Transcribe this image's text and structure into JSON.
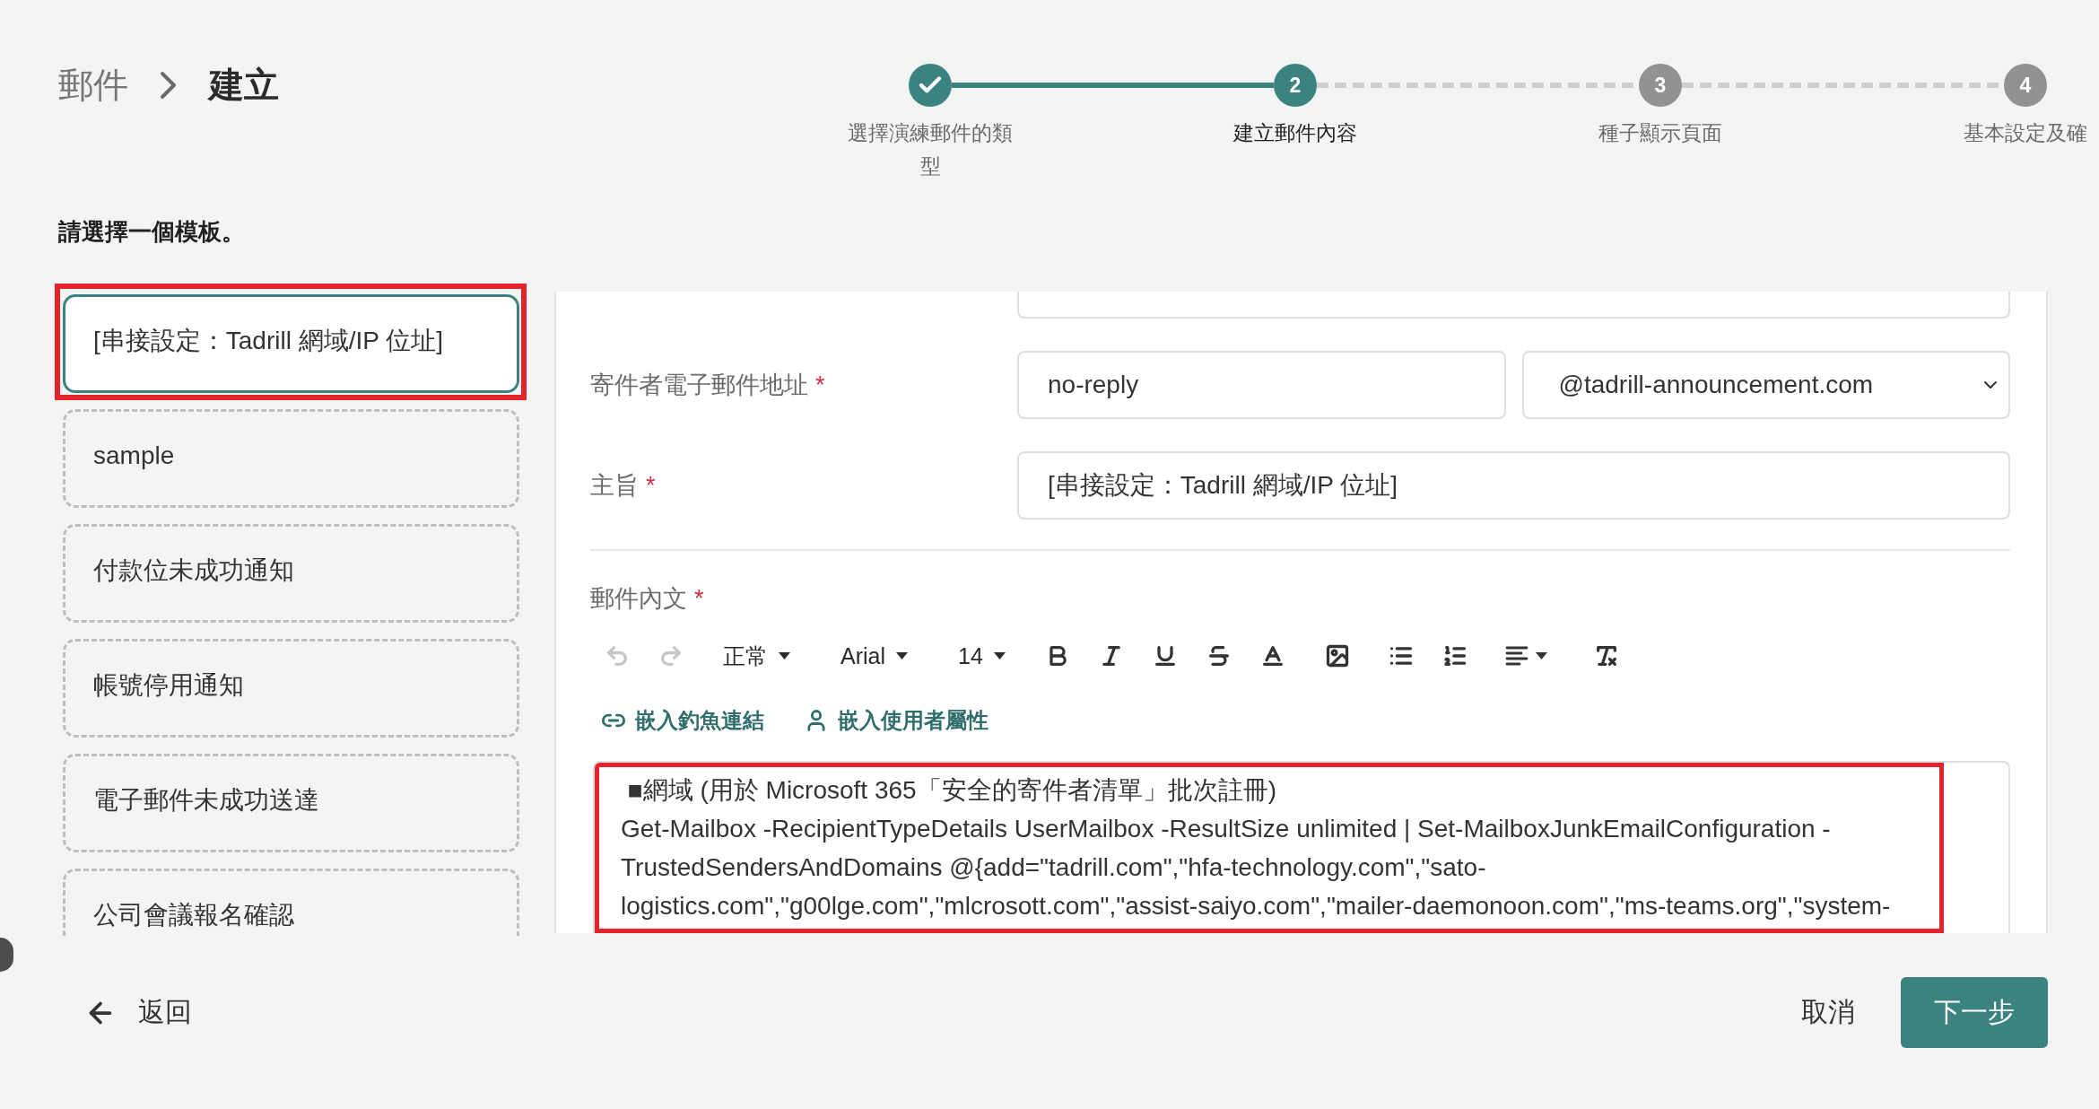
{
  "breadcrumb": [
    {
      "label": "郵件",
      "current": false
    },
    {
      "label": "建立",
      "current": true
    }
  ],
  "steps": [
    {
      "label": "選擇演練郵件的類型",
      "completed": true,
      "selected": false
    },
    {
      "number": "2",
      "label": "建立郵件內容",
      "completed": false,
      "selected": true
    },
    {
      "number": "3",
      "label": "種子顯示頁面",
      "completed": false,
      "selected": false
    },
    {
      "number": "4",
      "label": "基本設定及確",
      "completed": false,
      "selected": false
    }
  ],
  "instruction": "請選擇一個模板。",
  "templates": [
    {
      "label": "[串接設定：Tadrill 網域/IP 位址]",
      "selected": true
    },
    {
      "label": "sample",
      "selected": false
    },
    {
      "label": "付款位未成功通知",
      "selected": false
    },
    {
      "label": "帳號停用通知",
      "selected": false
    },
    {
      "label": "電子郵件未成功送達",
      "selected": false
    },
    {
      "label": "公司會議報名確認",
      "selected": false
    }
  ],
  "form": {
    "sender_email": {
      "label": "寄件者電子郵件地址",
      "required_mark": "*",
      "local_part": "no-reply",
      "domain": "@tadrill-announcement.com"
    },
    "subject": {
      "label": "主旨",
      "required_mark": "*",
      "value": "[串接設定：Tadrill 網域/IP 位址]"
    },
    "body": {
      "label": "郵件內文",
      "required_mark": "*",
      "toolbar": [
        {
          "kind": "undo",
          "disabled": true
        },
        {
          "kind": "redo",
          "disabled": true
        },
        {
          "kind": "dropdown",
          "value": "正常",
          "disabled": false
        },
        {
          "kind": "dropdown",
          "value": "Arial",
          "disabled": false
        },
        {
          "kind": "dropdown",
          "value": "14",
          "disabled": false
        },
        {
          "kind": "bold",
          "disabled": false
        },
        {
          "kind": "italic",
          "disabled": false
        },
        {
          "kind": "underline",
          "disabled": false
        },
        {
          "kind": "strike",
          "disabled": false
        },
        {
          "kind": "color",
          "disabled": false
        },
        {
          "kind": "image",
          "disabled": false
        },
        {
          "kind": "bullets",
          "disabled": false
        },
        {
          "kind": "numbering",
          "disabled": false
        },
        {
          "kind": "align",
          "disabled": false
        },
        {
          "kind": "clean",
          "disabled": false
        }
      ],
      "insert_links": [
        {
          "kind": "link",
          "label": "嵌入釣魚連結"
        },
        {
          "kind": "user",
          "label": "嵌入使用者屬性"
        }
      ],
      "paragraphs": [
        " ■網域 (用於 Microsoft 365「安全的寄件者清單」批次註冊)",
        "Get-Mailbox -RecipientTypeDetails UserMailbox -ResultSize unlimited | Set-MailboxJunkEmailConfiguration -TrustedSendersAndDomains @{add=\"tadrill.com\",\"hfa-technology.com\",\"sato-logistics.com\",\"g00lge.com\",\"mlcrosott.com\",\"assist-saiyo.com\",\"mailer-daemonoon.com\",\"ms-teams.org\",\"system-"
      ]
    }
  },
  "footer": {
    "back": "返回",
    "cancel": "取消",
    "next": "下一步"
  }
}
